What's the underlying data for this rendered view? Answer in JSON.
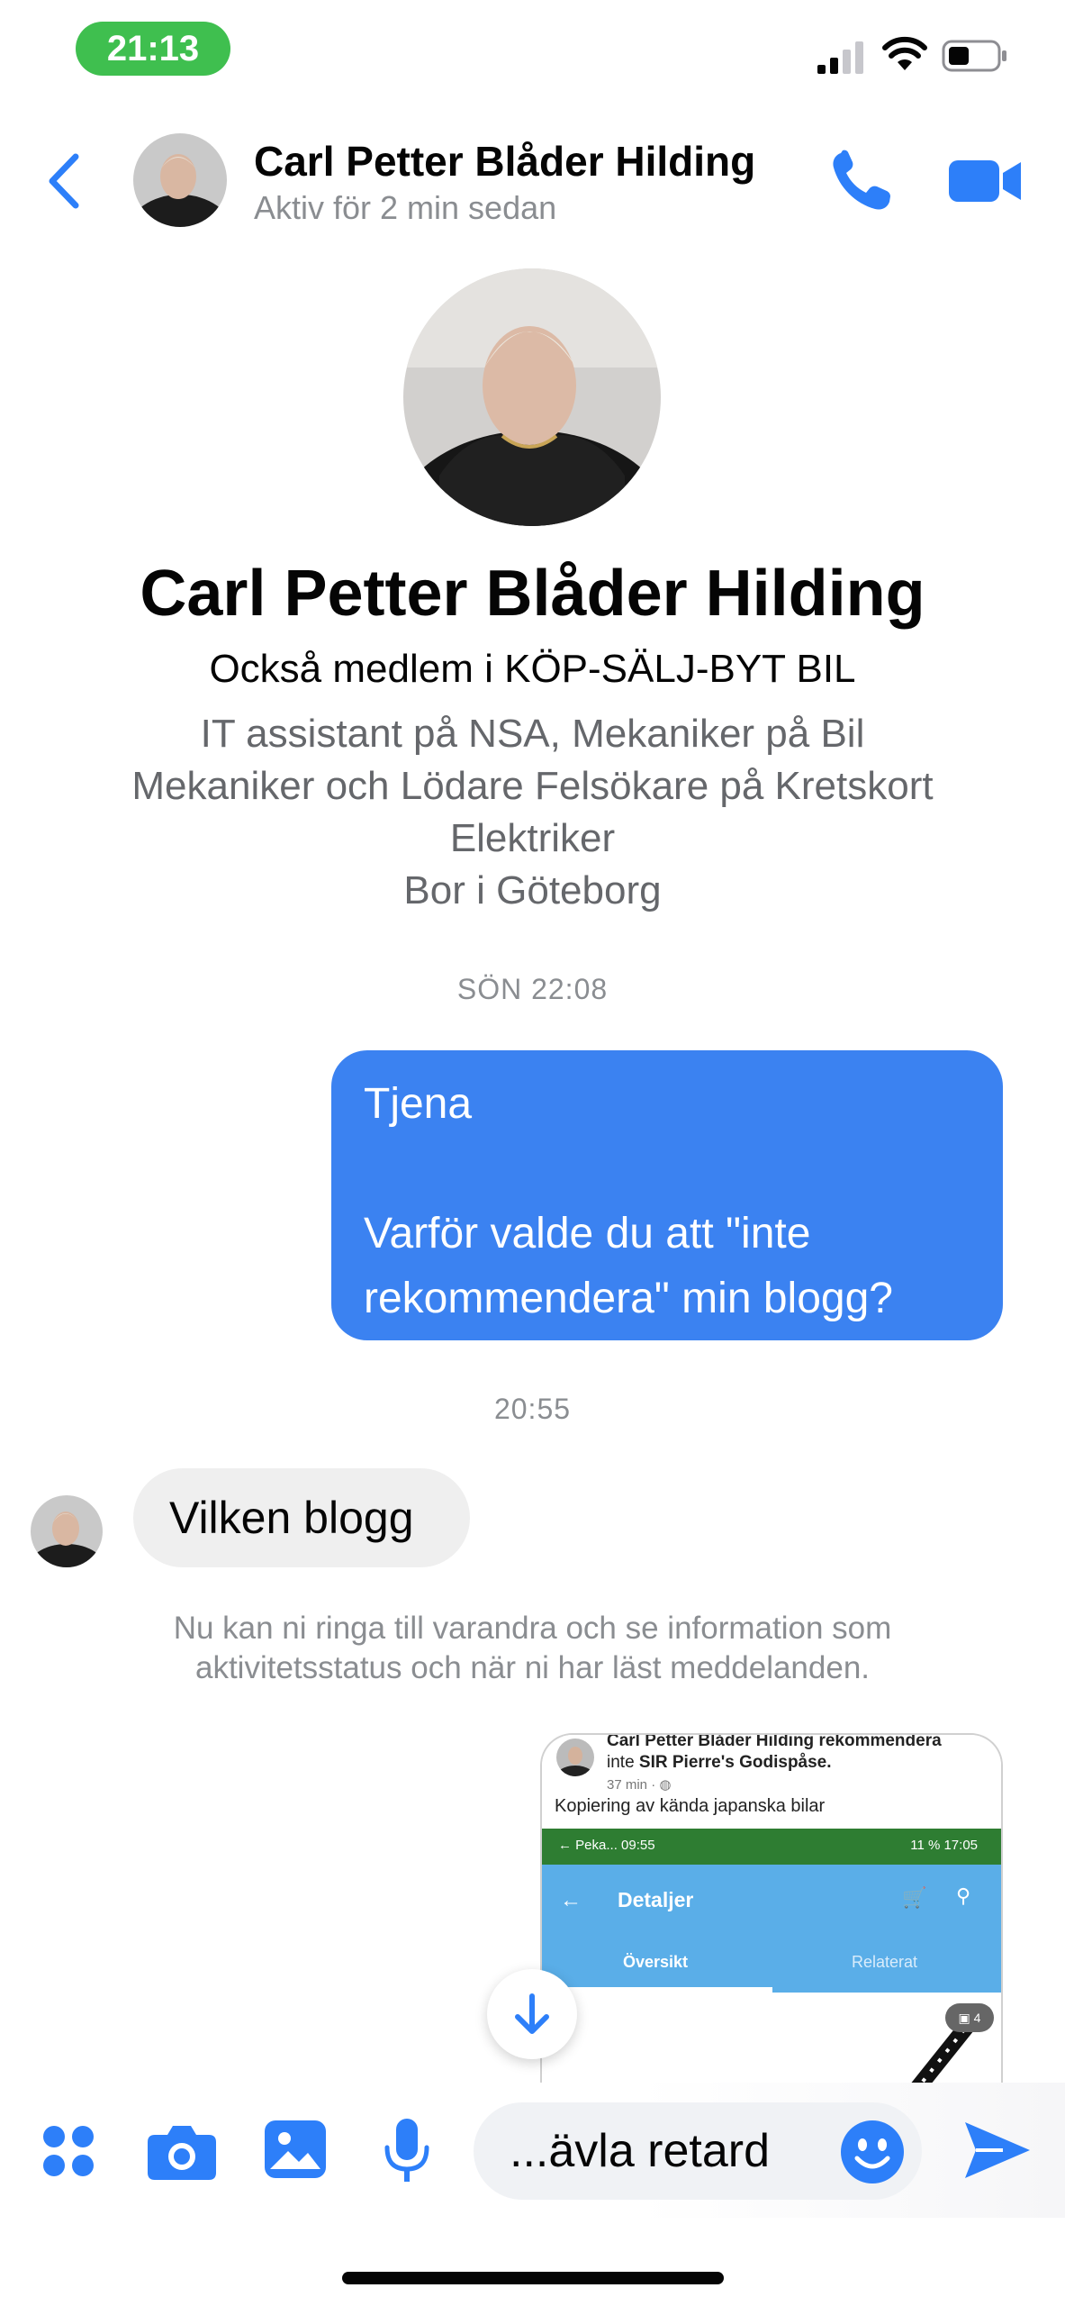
{
  "status_bar": {
    "time": "21:13"
  },
  "header": {
    "name": "Carl Petter Blåder Hilding",
    "activity": "Aktiv för 2 min sedan"
  },
  "profile": {
    "name": "Carl Petter Blåder Hilding",
    "membership": "Också medlem i KÖP-SÄLJ-BYT  BIL",
    "bio_lines": [
      "IT assistant på NSA, Mekaniker på Bil",
      "Mekaniker och Lödare Felsökare på Kretskort",
      "Elektriker",
      "Bor i Göteborg"
    ]
  },
  "messages": {
    "timestamp_1": "SÖN 22:08",
    "outgoing": {
      "line_1": "Tjena",
      "line_2": "",
      "line_3": "Varför valde du att \"inte",
      "line_4": "rekommendera\" min blogg?"
    },
    "timestamp_2": "20:55",
    "incoming": "Vilken blogg",
    "info_note": "Nu kan ni ringa till varandra och se information som aktivitetsstatus och när ni har läst meddelanden."
  },
  "attachment": {
    "author_line_1": "Carl Petter Blåder Hilding rekommendera",
    "author_line_2_prefix": "inte ",
    "author_line_2_bold": "SIR Pierre's Godispåse.",
    "meta": "37 min · ",
    "post_text": "Kopiering av kända japanska bilar",
    "status_left": "Peka... 09:55",
    "status_right": "11 %  17:05",
    "app_title": "Detaljer",
    "tab_overview": "Översikt",
    "tab_related": "Relaterat",
    "badge": "4"
  },
  "composer": {
    "message_text": "...ävla retard"
  },
  "colors": {
    "messenger_blue": "#3b82f1",
    "incoming_bubble": "#efefef",
    "status_green": "#3fbf4f"
  },
  "icons": [
    "back-chevron-icon",
    "phone-icon",
    "video-camera-icon",
    "menu-dots-icon",
    "camera-icon",
    "gallery-icon",
    "microphone-icon",
    "emoji-icon",
    "send-icon",
    "arrow-down-icon"
  ]
}
